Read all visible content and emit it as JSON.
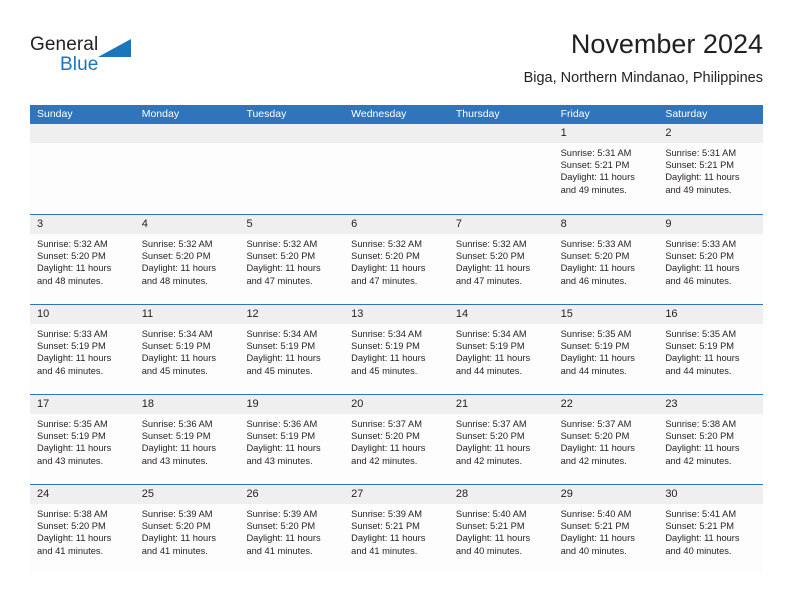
{
  "brand": {
    "word_one": "General",
    "word_two": "Blue",
    "triangle_icon": "triangle-icon",
    "accent_color": "#1b75bb"
  },
  "header": {
    "title": "November 2024",
    "subtitle": "Biga, Northern Mindanao, Philippines"
  },
  "theme": {
    "header_blue": "#3075bc",
    "day_number_bg": "#efefef",
    "cell_bg": "#fdfdfd",
    "text_color": "#231f20"
  },
  "calendar": {
    "day_headers": [
      "Sunday",
      "Monday",
      "Tuesday",
      "Wednesday",
      "Thursday",
      "Friday",
      "Saturday"
    ],
    "weeks": [
      [
        {
          "day": "",
          "empty": true,
          "lines": []
        },
        {
          "day": "",
          "empty": true,
          "lines": []
        },
        {
          "day": "",
          "empty": true,
          "lines": []
        },
        {
          "day": "",
          "empty": true,
          "lines": []
        },
        {
          "day": "",
          "empty": true,
          "lines": []
        },
        {
          "day": "1",
          "empty": false,
          "lines": [
            "Sunrise: 5:31 AM",
            "Sunset: 5:21 PM",
            "Daylight: 11 hours",
            "and 49 minutes."
          ]
        },
        {
          "day": "2",
          "empty": false,
          "lines": [
            "Sunrise: 5:31 AM",
            "Sunset: 5:21 PM",
            "Daylight: 11 hours",
            "and 49 minutes."
          ]
        }
      ],
      [
        {
          "day": "3",
          "empty": false,
          "lines": [
            "Sunrise: 5:32 AM",
            "Sunset: 5:20 PM",
            "Daylight: 11 hours",
            "and 48 minutes."
          ]
        },
        {
          "day": "4",
          "empty": false,
          "lines": [
            "Sunrise: 5:32 AM",
            "Sunset: 5:20 PM",
            "Daylight: 11 hours",
            "and 48 minutes."
          ]
        },
        {
          "day": "5",
          "empty": false,
          "lines": [
            "Sunrise: 5:32 AM",
            "Sunset: 5:20 PM",
            "Daylight: 11 hours",
            "and 47 minutes."
          ]
        },
        {
          "day": "6",
          "empty": false,
          "lines": [
            "Sunrise: 5:32 AM",
            "Sunset: 5:20 PM",
            "Daylight: 11 hours",
            "and 47 minutes."
          ]
        },
        {
          "day": "7",
          "empty": false,
          "lines": [
            "Sunrise: 5:32 AM",
            "Sunset: 5:20 PM",
            "Daylight: 11 hours",
            "and 47 minutes."
          ]
        },
        {
          "day": "8",
          "empty": false,
          "lines": [
            "Sunrise: 5:33 AM",
            "Sunset: 5:20 PM",
            "Daylight: 11 hours",
            "and 46 minutes."
          ]
        },
        {
          "day": "9",
          "empty": false,
          "lines": [
            "Sunrise: 5:33 AM",
            "Sunset: 5:20 PM",
            "Daylight: 11 hours",
            "and 46 minutes."
          ]
        }
      ],
      [
        {
          "day": "10",
          "empty": false,
          "lines": [
            "Sunrise: 5:33 AM",
            "Sunset: 5:19 PM",
            "Daylight: 11 hours",
            "and 46 minutes."
          ]
        },
        {
          "day": "11",
          "empty": false,
          "lines": [
            "Sunrise: 5:34 AM",
            "Sunset: 5:19 PM",
            "Daylight: 11 hours",
            "and 45 minutes."
          ]
        },
        {
          "day": "12",
          "empty": false,
          "lines": [
            "Sunrise: 5:34 AM",
            "Sunset: 5:19 PM",
            "Daylight: 11 hours",
            "and 45 minutes."
          ]
        },
        {
          "day": "13",
          "empty": false,
          "lines": [
            "Sunrise: 5:34 AM",
            "Sunset: 5:19 PM",
            "Daylight: 11 hours",
            "and 45 minutes."
          ]
        },
        {
          "day": "14",
          "empty": false,
          "lines": [
            "Sunrise: 5:34 AM",
            "Sunset: 5:19 PM",
            "Daylight: 11 hours",
            "and 44 minutes."
          ]
        },
        {
          "day": "15",
          "empty": false,
          "lines": [
            "Sunrise: 5:35 AM",
            "Sunset: 5:19 PM",
            "Daylight: 11 hours",
            "and 44 minutes."
          ]
        },
        {
          "day": "16",
          "empty": false,
          "lines": [
            "Sunrise: 5:35 AM",
            "Sunset: 5:19 PM",
            "Daylight: 11 hours",
            "and 44 minutes."
          ]
        }
      ],
      [
        {
          "day": "17",
          "empty": false,
          "lines": [
            "Sunrise: 5:35 AM",
            "Sunset: 5:19 PM",
            "Daylight: 11 hours",
            "and 43 minutes."
          ]
        },
        {
          "day": "18",
          "empty": false,
          "lines": [
            "Sunrise: 5:36 AM",
            "Sunset: 5:19 PM",
            "Daylight: 11 hours",
            "and 43 minutes."
          ]
        },
        {
          "day": "19",
          "empty": false,
          "lines": [
            "Sunrise: 5:36 AM",
            "Sunset: 5:19 PM",
            "Daylight: 11 hours",
            "and 43 minutes."
          ]
        },
        {
          "day": "20",
          "empty": false,
          "lines": [
            "Sunrise: 5:37 AM",
            "Sunset: 5:20 PM",
            "Daylight: 11 hours",
            "and 42 minutes."
          ]
        },
        {
          "day": "21",
          "empty": false,
          "lines": [
            "Sunrise: 5:37 AM",
            "Sunset: 5:20 PM",
            "Daylight: 11 hours",
            "and 42 minutes."
          ]
        },
        {
          "day": "22",
          "empty": false,
          "lines": [
            "Sunrise: 5:37 AM",
            "Sunset: 5:20 PM",
            "Daylight: 11 hours",
            "and 42 minutes."
          ]
        },
        {
          "day": "23",
          "empty": false,
          "lines": [
            "Sunrise: 5:38 AM",
            "Sunset: 5:20 PM",
            "Daylight: 11 hours",
            "and 42 minutes."
          ]
        }
      ],
      [
        {
          "day": "24",
          "empty": false,
          "lines": [
            "Sunrise: 5:38 AM",
            "Sunset: 5:20 PM",
            "Daylight: 11 hours",
            "and 41 minutes."
          ]
        },
        {
          "day": "25",
          "empty": false,
          "lines": [
            "Sunrise: 5:39 AM",
            "Sunset: 5:20 PM",
            "Daylight: 11 hours",
            "and 41 minutes."
          ]
        },
        {
          "day": "26",
          "empty": false,
          "lines": [
            "Sunrise: 5:39 AM",
            "Sunset: 5:20 PM",
            "Daylight: 11 hours",
            "and 41 minutes."
          ]
        },
        {
          "day": "27",
          "empty": false,
          "lines": [
            "Sunrise: 5:39 AM",
            "Sunset: 5:21 PM",
            "Daylight: 11 hours",
            "and 41 minutes."
          ]
        },
        {
          "day": "28",
          "empty": false,
          "lines": [
            "Sunrise: 5:40 AM",
            "Sunset: 5:21 PM",
            "Daylight: 11 hours",
            "and 40 minutes."
          ]
        },
        {
          "day": "29",
          "empty": false,
          "lines": [
            "Sunrise: 5:40 AM",
            "Sunset: 5:21 PM",
            "Daylight: 11 hours",
            "and 40 minutes."
          ]
        },
        {
          "day": "30",
          "empty": false,
          "lines": [
            "Sunrise: 5:41 AM",
            "Sunset: 5:21 PM",
            "Daylight: 11 hours",
            "and 40 minutes."
          ]
        }
      ]
    ]
  }
}
